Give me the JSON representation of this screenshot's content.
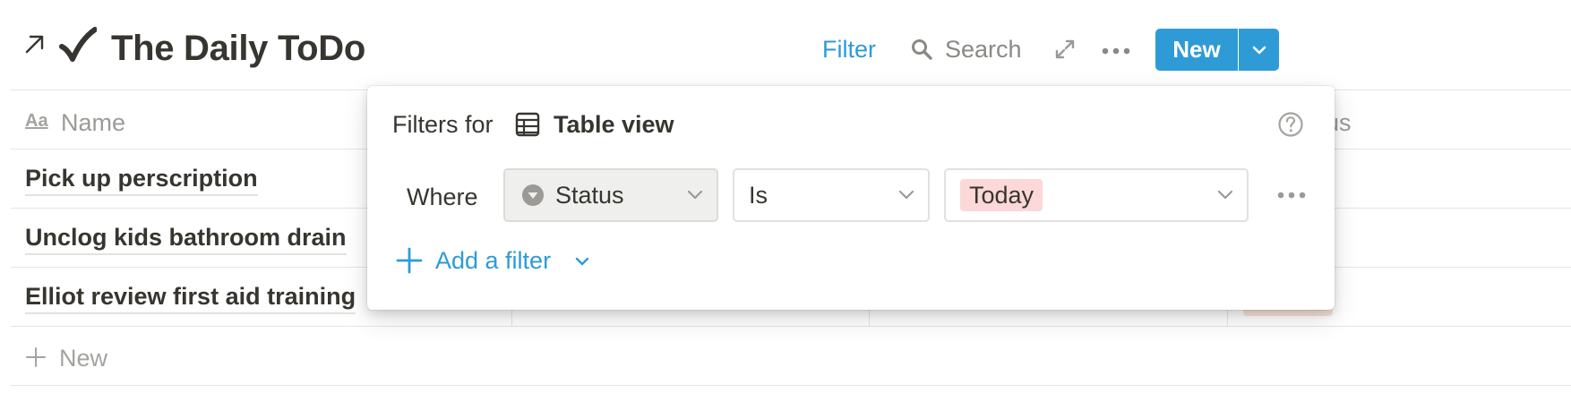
{
  "header": {
    "title": "The Daily ToDo",
    "filter_label": "Filter",
    "search_label": "Search",
    "new_label": "New"
  },
  "table": {
    "columns": {
      "name_icon": "Aa",
      "name": "Name",
      "status_partial": "us"
    },
    "rows": [
      {
        "name": "Pick up perscription"
      },
      {
        "name": "Unclog kids bathroom drain"
      },
      {
        "name": "Elliot review first aid training"
      }
    ],
    "add_row_label": "New"
  },
  "filter_popup": {
    "heading": "Filters for",
    "view_name": "Table view",
    "rule": {
      "conjunction": "Where",
      "property": "Status",
      "operator": "Is",
      "value": "Today"
    },
    "add_filter_label": "Add a filter"
  },
  "colors": {
    "accent": "#2f9bd6",
    "today_tag_bg": "#fcd8d8",
    "text": "#37352f",
    "muted": "#9b9a97"
  },
  "icons": {
    "open": "arrow-up-right-icon",
    "page": "checkmark-icon",
    "search": "search-icon",
    "expand": "expand-icon",
    "more": "more-icon",
    "table_view": "table-icon",
    "help": "help-icon",
    "status_property": "status-icon",
    "add": "plus-icon"
  }
}
